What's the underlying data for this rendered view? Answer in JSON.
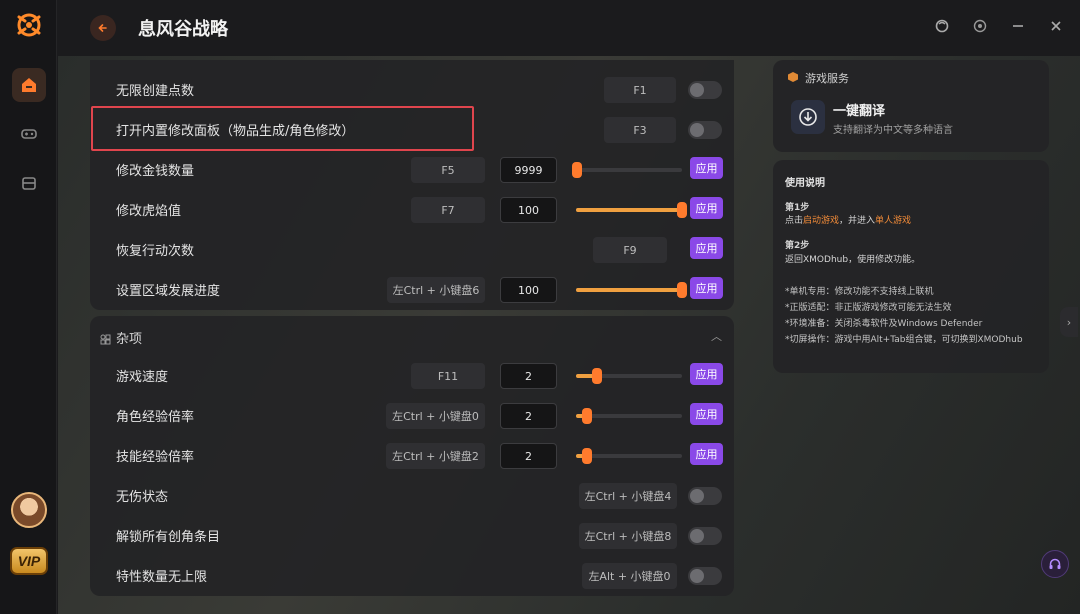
{
  "header": {
    "title": "息风谷战略"
  },
  "top_rows": [
    {
      "label": "无限创建点数",
      "key": "F1"
    },
    {
      "label": "打开内置修改面板（物品生成/角色修改）",
      "key": "F3"
    }
  ],
  "value_rows": [
    {
      "label": "修改金钱数量",
      "key": "F5",
      "value": "9999",
      "apply": "应用"
    },
    {
      "label": "修改虎焰值",
      "key": "F7",
      "value": "100",
      "apply": "应用"
    },
    {
      "label": "恢复行动次数",
      "key": "F9",
      "apply": "应用"
    },
    {
      "label": "设置区域发展进度",
      "key": "左Ctrl + 小键盘6",
      "value": "100",
      "apply": "应用"
    }
  ],
  "misc": {
    "title": "杂项",
    "rows": [
      {
        "label": "游戏速度",
        "key": "F11",
        "value": "2",
        "apply": "应用"
      },
      {
        "label": "角色经验倍率",
        "key": "左Ctrl + 小键盘0",
        "value": "2",
        "apply": "应用"
      },
      {
        "label": "技能经验倍率",
        "key": "左Ctrl + 小键盘2",
        "value": "2",
        "apply": "应用"
      },
      {
        "label": "无伤状态",
        "key": "左Ctrl + 小键盘4"
      },
      {
        "label": "解锁所有创角条目",
        "key": "左Ctrl + 小键盘8"
      },
      {
        "label": "特性数量无上限",
        "key": "左Alt + 小键盘0"
      }
    ]
  },
  "service": {
    "header": "游戏服务",
    "name": "一键翻译",
    "desc": "支持翻译为中文等多种语言"
  },
  "guide": {
    "title": "使用说明",
    "step1_title": "第1步",
    "step1_a": "点击",
    "step1_link1": "启动游戏",
    "step1_b": "，并进入",
    "step1_link2": "单人游戏",
    "step2_title": "第2步",
    "step2_text": "返回XMODhub，使用修改功能。",
    "notes": [
      "*单机专用：修改功能不支持线上联机",
      "*正版适配：非正版游戏修改可能无法生效",
      "*环境准备：关闭杀毒软件及Windows Defender",
      "*切屏操作：游戏中用Alt+Tab组合键，可切换到XMODhub"
    ]
  },
  "vip_label": "VIP",
  "colors": {
    "accent": "#ff7b2d",
    "apply": "#8a49e8",
    "highlight": "#e0454d"
  }
}
